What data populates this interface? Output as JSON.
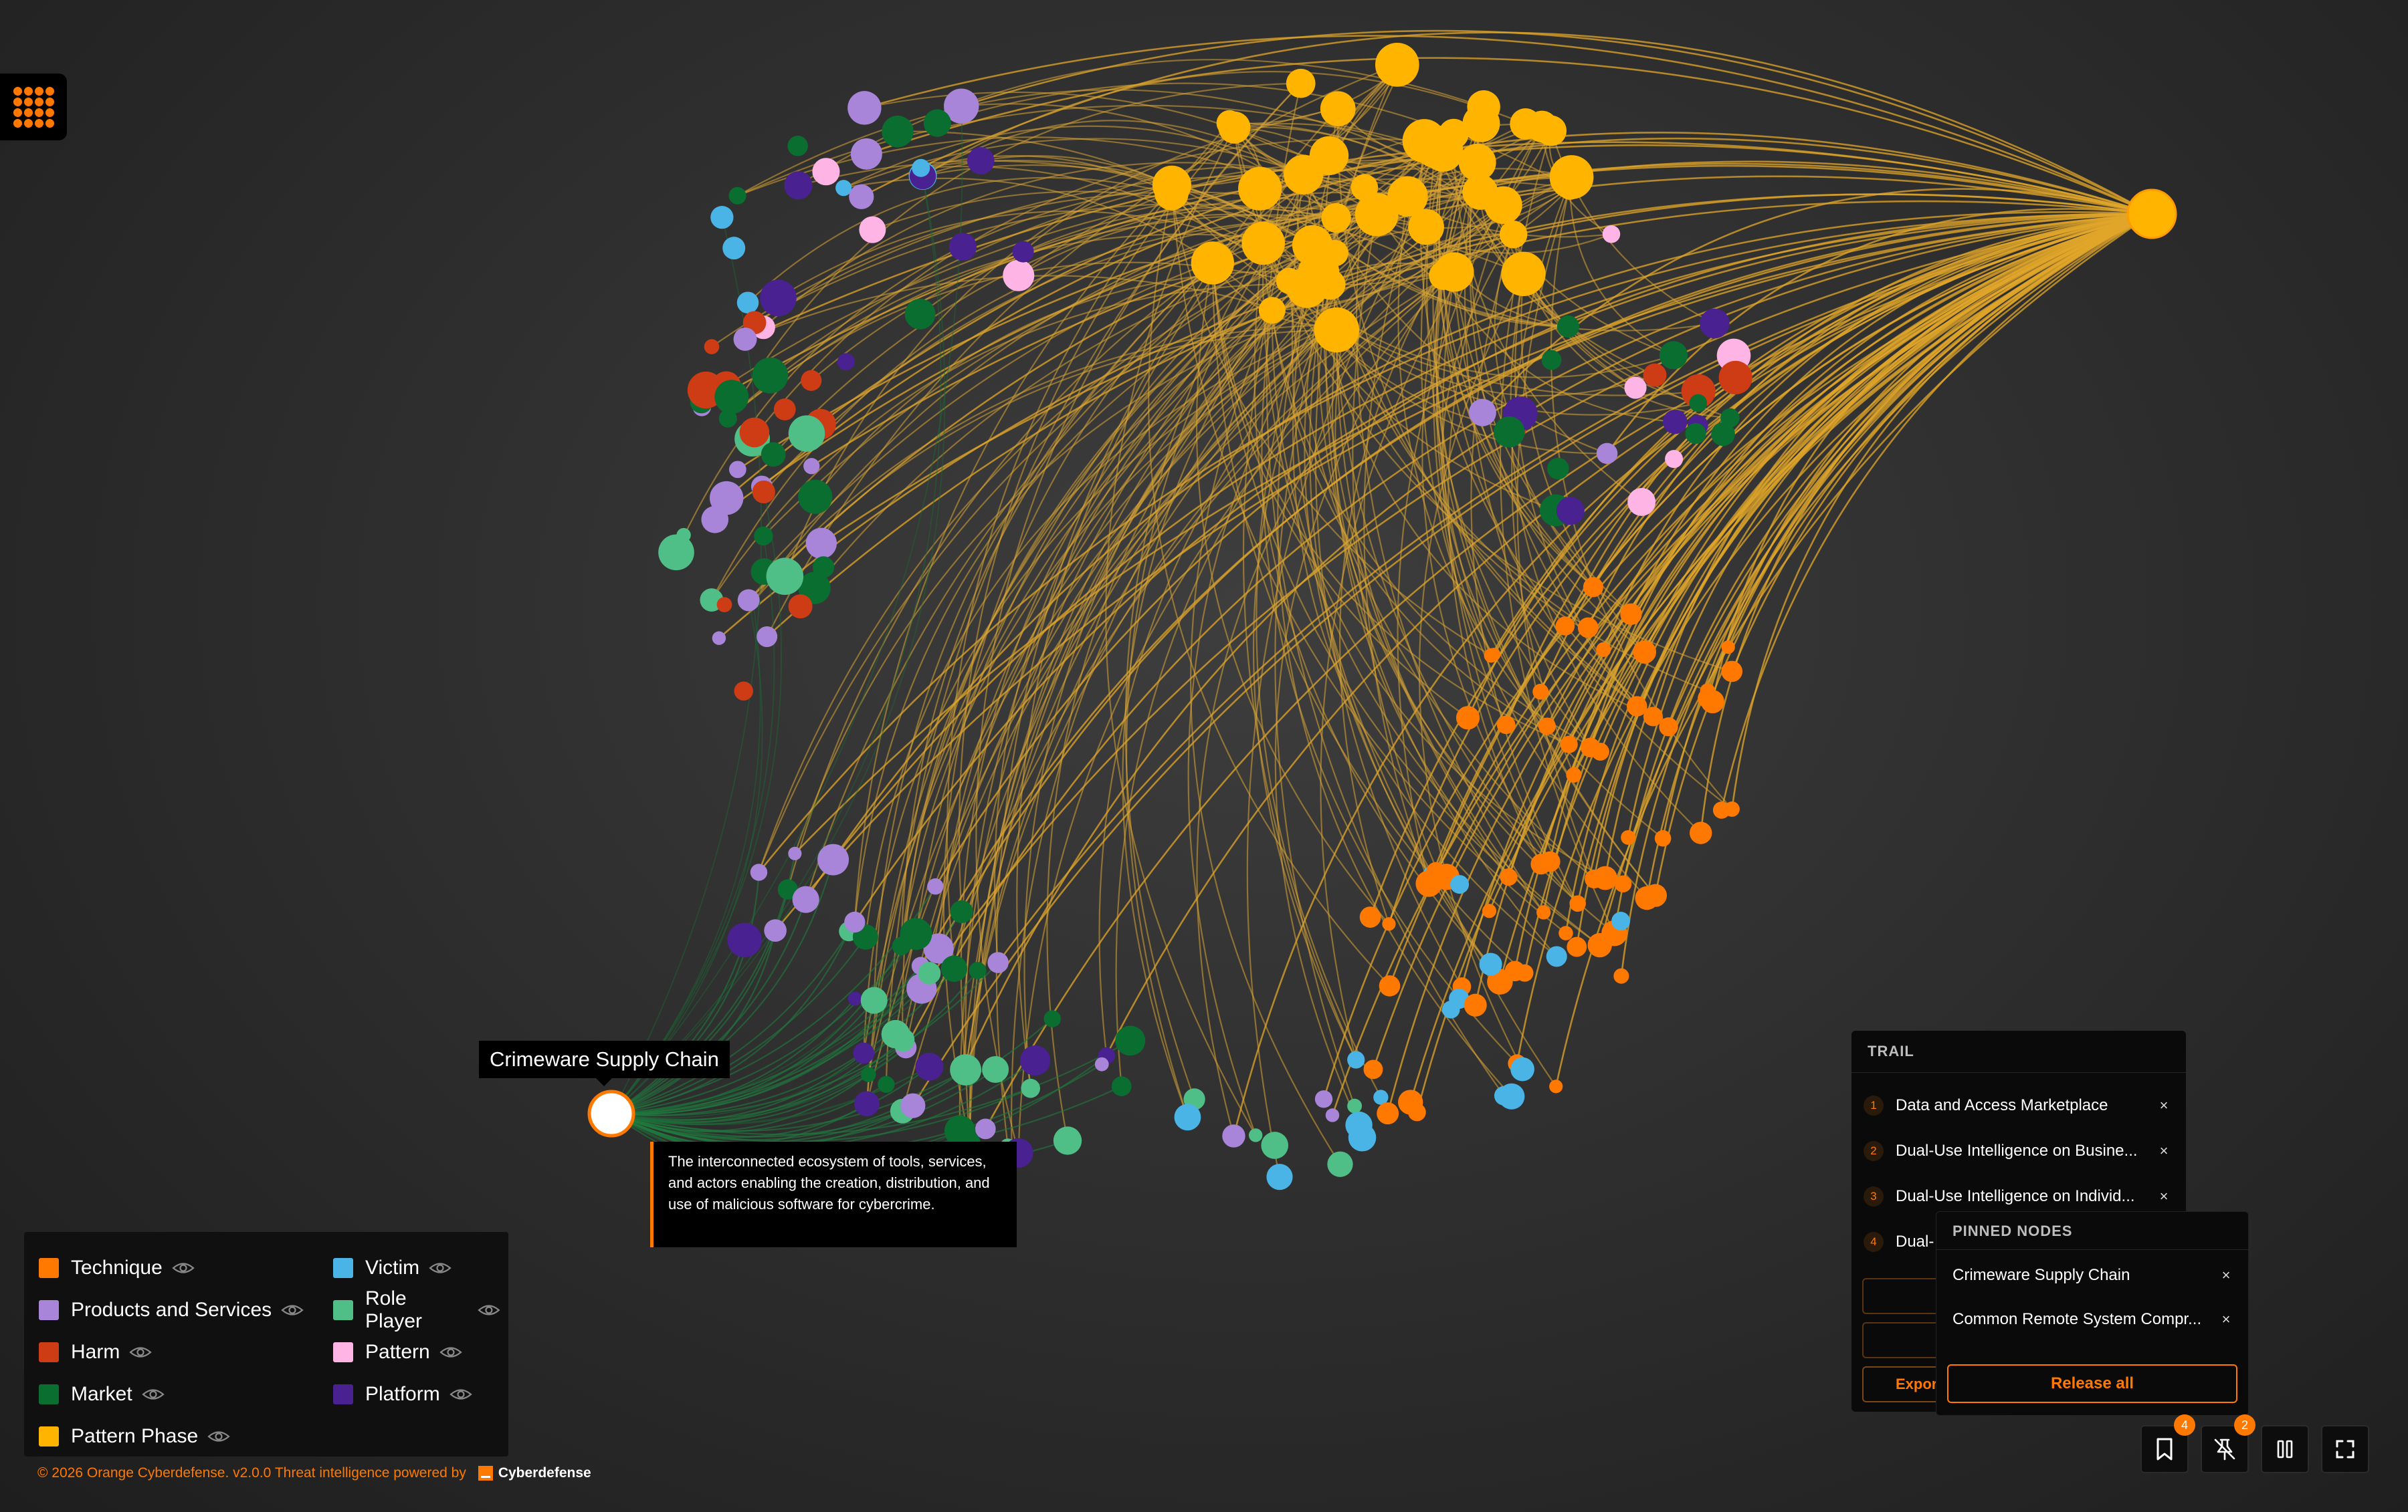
{
  "graph": {
    "focused_node": {
      "label": "Crimeware Supply Chain",
      "description": "The interconnected ecosystem of tools, services, and actors enabling the creation, distribution, and use of malicious software for cybercrime."
    }
  },
  "legend": {
    "items": [
      {
        "label": "Technique",
        "color": "#ff7900"
      },
      {
        "label": "Victim",
        "color": "#4bb4e6"
      },
      {
        "label": "Products and Services",
        "color": "#a885d8"
      },
      {
        "label": "Role Player",
        "color": "#50be87"
      },
      {
        "label": "Harm",
        "color": "#cd3c14"
      },
      {
        "label": "Pattern",
        "color": "#ffb4e6"
      },
      {
        "label": "Market",
        "color": "#0a6e31"
      },
      {
        "label": "Platform",
        "color": "#492191"
      },
      {
        "label": "Pattern Phase",
        "color": "#ffb400"
      }
    ]
  },
  "footer": {
    "copyright": "© 2026 Orange Cyberdefense. v2.0.0 Threat intelligence powered by",
    "brand": "Cyberdefense"
  },
  "trail": {
    "title": "TRAIL",
    "items": [
      {
        "num": "1",
        "label": "Data and Access Marketplace"
      },
      {
        "num": "2",
        "label": "Dual-Use Intelligence on Busine..."
      },
      {
        "num": "3",
        "label": "Dual-Use Intelligence on Individ..."
      },
      {
        "num": "4",
        "label": "Dual-"
      }
    ],
    "export_label": "Expor"
  },
  "pinned": {
    "title": "PINNED NODES",
    "items": [
      {
        "label": "Crimeware Supply Chain"
      },
      {
        "label": "Common Remote System Compr..."
      }
    ],
    "release_label": "Release all"
  },
  "toolbar": {
    "bookmarks_badge": "4",
    "unpin_badge": "2"
  }
}
